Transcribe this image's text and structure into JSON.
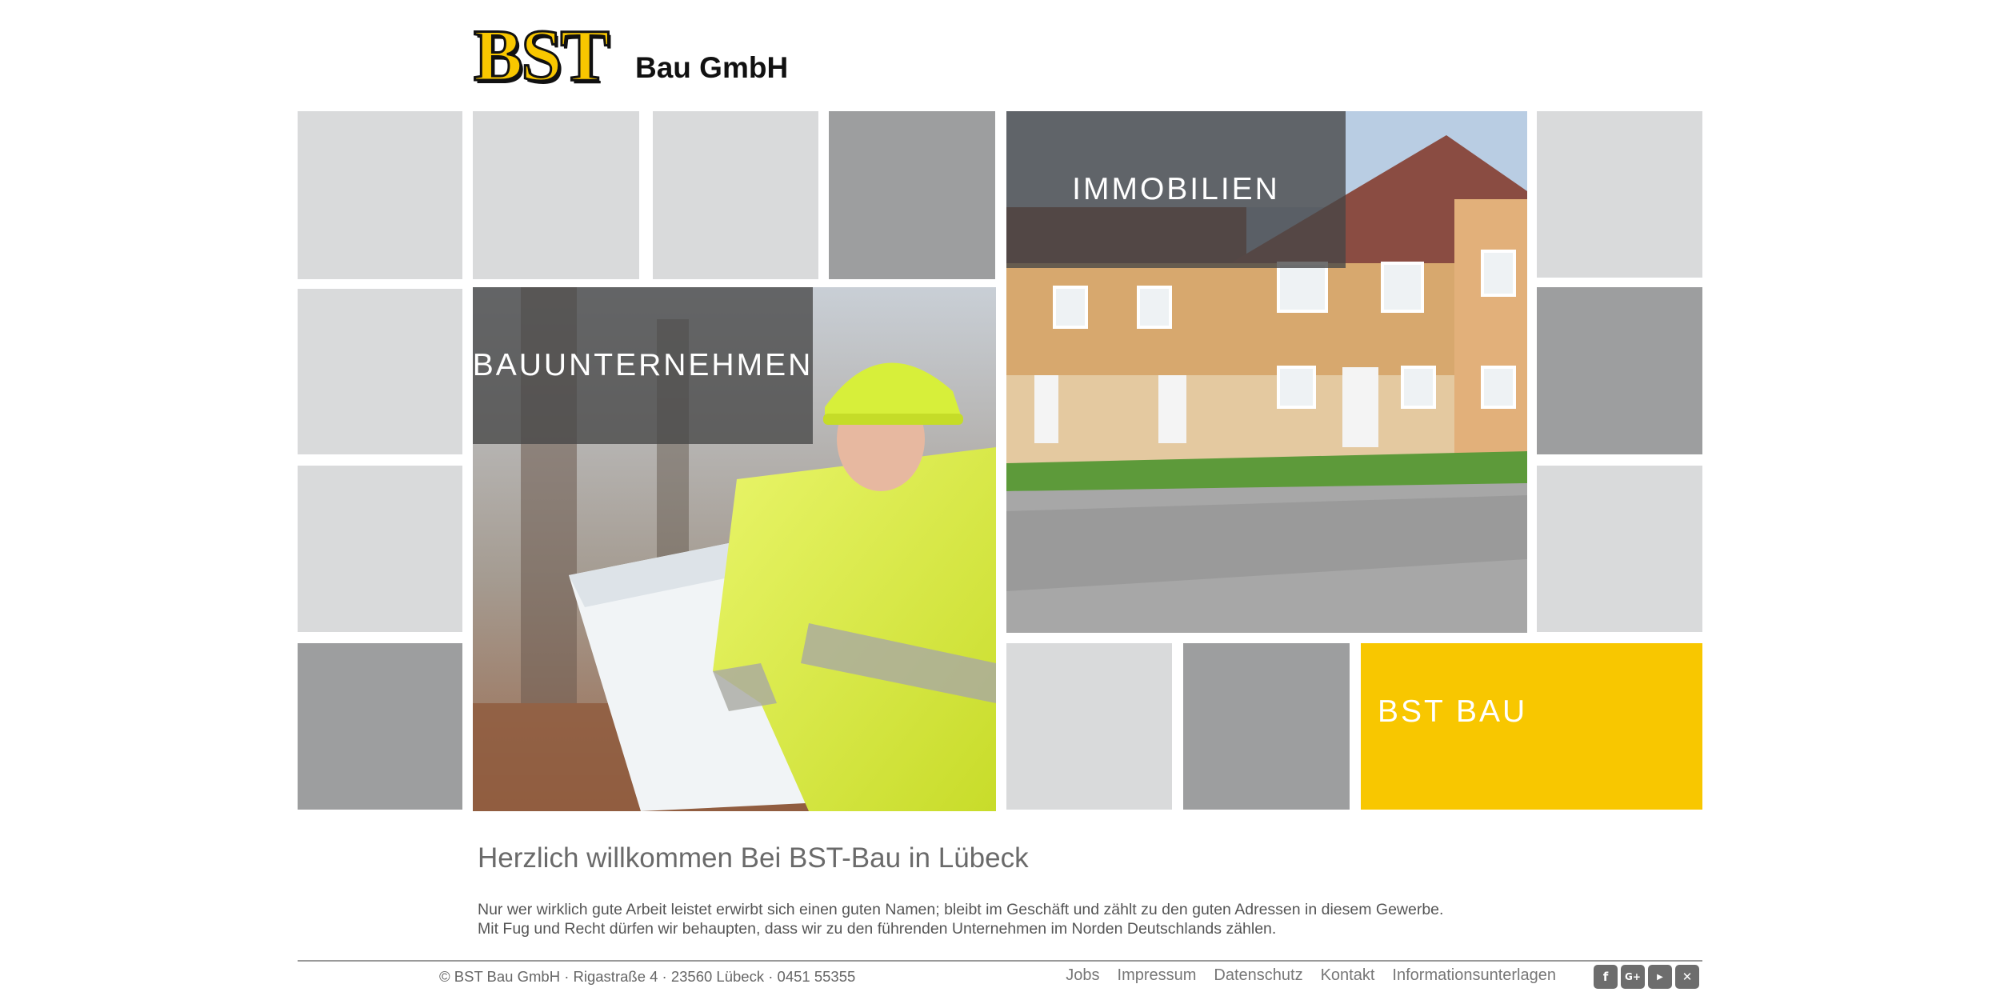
{
  "logo": {
    "mark": "BST",
    "company": "Bau GmbH"
  },
  "tiles": {
    "bauunternehmen_label": "BAUUNTERNEHMEN",
    "immobilien_label": "IMMOBILIEN",
    "bstbau_label": "BST BAU"
  },
  "colors": {
    "accent": "#f8c700",
    "tile_light": "#d9dadb",
    "tile_dark": "#9d9e9f"
  },
  "main": {
    "heading": "Herzlich willkommen Bei BST-Bau in Lübeck",
    "paragraph_line1": "Nur wer wirklich gute Arbeit leistet erwirbt sich einen guten Namen; bleibt im Geschäft und zählt zu den guten Adressen in diesem Gewerbe.",
    "paragraph_line2": "Mit Fug und Recht dürfen wir behaupten, dass wir zu den führenden Unternehmen im Norden Deutschlands zählen."
  },
  "footer": {
    "copyright": "© BST Bau GmbH · Rigastraße 4 · 23560 Lübeck · 0451 55355",
    "links": [
      "Jobs",
      "Impressum",
      "Datenschutz",
      "Kontakt",
      "Informationsunterlagen"
    ],
    "social_icons": [
      "facebook-icon",
      "google-plus-icon",
      "youtube-icon",
      "xing-icon"
    ]
  }
}
